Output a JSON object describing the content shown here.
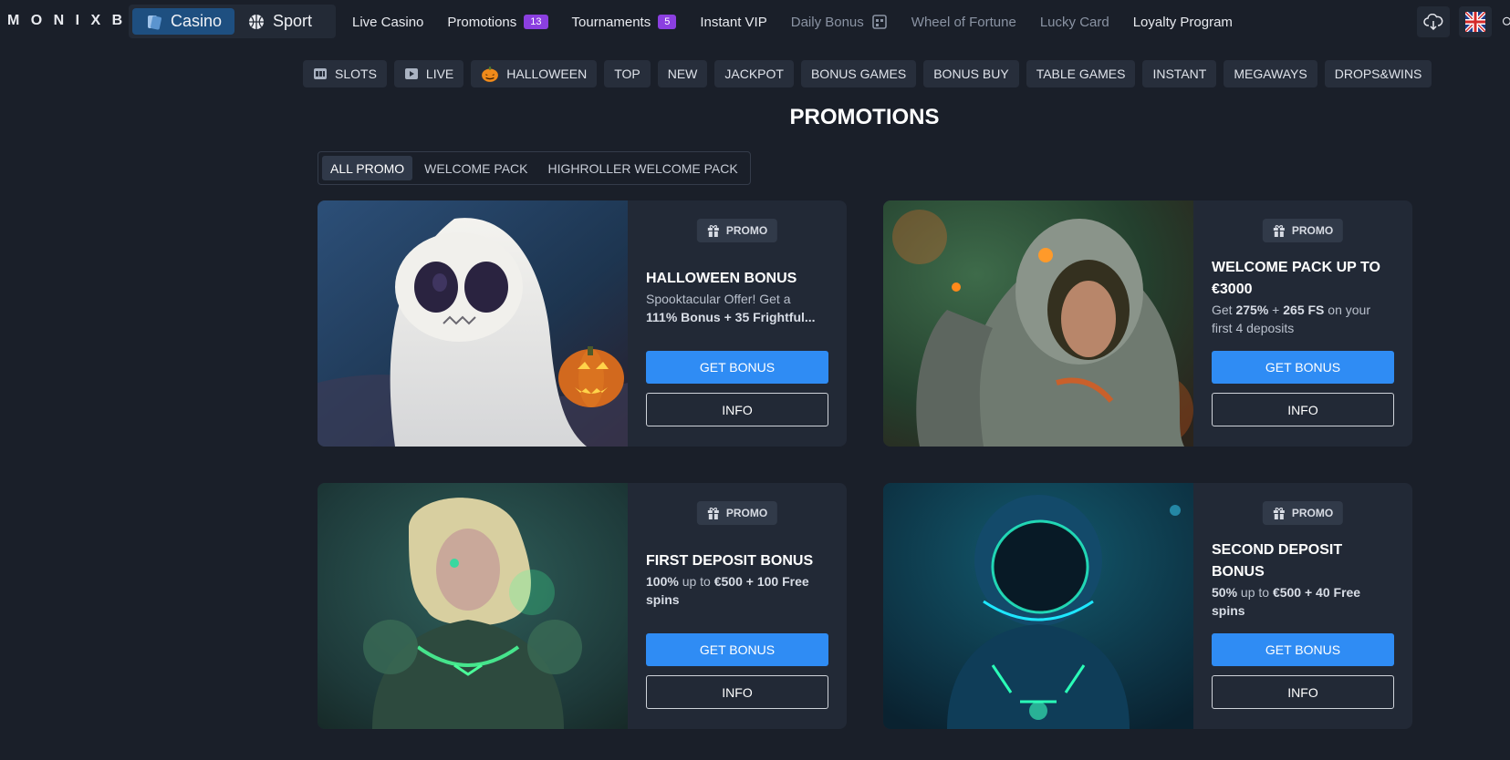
{
  "header": {
    "logo": "M O N I X B E T",
    "switch": {
      "casino": "Casino",
      "sport": "Sport"
    },
    "nav": [
      {
        "label": "Live Casino"
      },
      {
        "label": "Promotions",
        "badge": "13"
      },
      {
        "label": "Tournaments",
        "badge": "5"
      },
      {
        "label": "Instant VIP"
      },
      {
        "label": "Daily Bonus"
      },
      {
        "label": "Wheel of Fortune"
      },
      {
        "label": "Lucky Card"
      },
      {
        "label": "Loyalty Program"
      }
    ]
  },
  "categories": [
    {
      "label": "SLOTS",
      "icon": "slots-icon"
    },
    {
      "label": "LIVE",
      "icon": "live-play-icon"
    },
    {
      "label": "HALLOWEEN",
      "icon": "pumpkin-icon"
    },
    {
      "label": "TOP"
    },
    {
      "label": "NEW"
    },
    {
      "label": "JACKPOT"
    },
    {
      "label": "BONUS GAMES"
    },
    {
      "label": "BONUS BUY"
    },
    {
      "label": "TABLE GAMES"
    },
    {
      "label": "INSTANT"
    },
    {
      "label": "MEGAWAYS"
    },
    {
      "label": "DROPS&WINS"
    }
  ],
  "page": {
    "title": "PROMOTIONS"
  },
  "filters": [
    "ALL PROMO",
    "WELCOME PACK",
    "HIGHROLLER WELCOME PACK"
  ],
  "tag": "PROMO",
  "buttons": {
    "get": "GET BONUS",
    "info": "INFO"
  },
  "cards": [
    {
      "title": "HALLOWEEN BONUS",
      "line1": "Spooktacular Offer! Get a",
      "line2a": "111% Bonus + 35 Frightful",
      "line2b": "..."
    },
    {
      "title_1": "WELCOME PACK UP TO",
      "title_2": "€3000",
      "d1": "Get ",
      "d2": "275%",
      "d3": " + ",
      "d4": "265 FS",
      "d5": " on your",
      "d6": "first 4 deposits"
    },
    {
      "title": "FIRST DEPOSIT BONUS",
      "d1": "100%",
      "d2": " up to ",
      "d3": "€500 + 100 Free",
      "d4": "spins"
    },
    {
      "title_1": "SECOND DEPOSIT",
      "title_2": "BONUS",
      "d1": "50%",
      "d2": " up to ",
      "d3": "€500 + 40 Free",
      "d4": "spins"
    }
  ],
  "colors": {
    "background": "#1a1f29",
    "card": "#222936",
    "accent": "#2f8cf4",
    "badge": "#8b3fe0"
  }
}
